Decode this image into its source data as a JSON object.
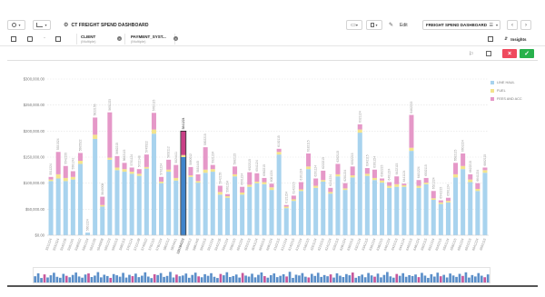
{
  "toolbar": {
    "title": "CT FREIGHT SPEND DASHBOARD",
    "edit_label": "Edit",
    "dashboard_label": "FREIGHT SPEND DASHBOARD",
    "insights_label": "Insights"
  },
  "filters": [
    {
      "name": "CLIENT",
      "value": "(Multiple)"
    },
    {
      "name": "PAYMENT_SYST...",
      "value": "(Multiple)"
    }
  ],
  "icons": {
    "dash_menu": "dashboard-icon",
    "chart_type": "chart-icon",
    "settings": "gear-icon",
    "comment": "comment-icon",
    "save": "save-icon",
    "pen": "pen-icon",
    "prev": "chevron-left-icon",
    "next": "chevron-right-icon",
    "cancel": "close-icon",
    "confirm": "check-icon"
  },
  "colors": {
    "line_haul": "#a8d3ee",
    "fuel": "#f3e38c",
    "fees_and_acc": "#e598c8",
    "selected_line_haul": "#3f84cb",
    "selected_fees": "#c93f86",
    "cancel_btn": "#ef4a5e",
    "confirm_btn": "#28b14c"
  },
  "chart_data": {
    "type": "bar",
    "stacked": true,
    "ylim": [
      0,
      300000
    ],
    "yticks": [
      "$300,000.00",
      "$250,000.00",
      "$200,000.00",
      "$150,000.00",
      "$100,000.00",
      "$50,000.00",
      "$0.00"
    ],
    "selected_index": 18,
    "selected_label": "159184223",
    "legend": [
      "LINE HAUL",
      "FUEL",
      "FEES AND ACC"
    ],
    "categories": [
      "5511224",
      "5531524",
      "5542155",
      "5561241",
      "5585522",
      "5601224",
      "5622155",
      "5640008",
      "5651223",
      "5662215",
      "5682115",
      "5701124",
      "5722148",
      "5745522",
      "5762115",
      "5781224",
      "5802112",
      "5824411",
      "5841224",
      "5860012",
      "5881445",
      "5902215",
      "5921224",
      "5942155",
      "5961224",
      "5982115",
      "6001224",
      "6022115",
      "6041124",
      "6062215",
      "6081224",
      "6102115",
      "6121224",
      "6142215",
      "6161224",
      "6182115",
      "6201124",
      "6222215",
      "6241224",
      "6262115",
      "6281224",
      "6302215",
      "6321124",
      "6342115",
      "6361224",
      "6382215",
      "6401224",
      "6422115",
      "6441124",
      "6462215",
      "6481224",
      "6502115",
      "6521224",
      "6542215",
      "6561124",
      "6582115",
      "6601224",
      "6622215",
      "6641224",
      "6662115"
    ],
    "series": [
      {
        "name": "LINE HAUL",
        "values": [
          104000,
          109000,
          104000,
          107000,
          137000,
          5000,
          185000,
          55000,
          145000,
          125000,
          122000,
          118000,
          114000,
          128000,
          195000,
          100000,
          122000,
          105000,
          150000,
          112000,
          101000,
          120000,
          122000,
          78000,
          72000,
          113000,
          78000,
          93000,
          100000,
          98000,
          87000,
          155000,
          52000,
          66000,
          85000,
          127000,
          91000,
          103000,
          80000,
          113000,
          87000,
          111000,
          197000,
          114000,
          106000,
          101000,
          91000,
          93000,
          93000,
          162000,
          91000,
          98000,
          68000,
          60000,
          63000,
          111000,
          127000,
          102000,
          85000,
          120000
        ]
      },
      {
        "name": "FUEL",
        "values": [
          3000,
          8000,
          6000,
          5000,
          6000,
          0,
          8000,
          3000,
          4000,
          5000,
          5000,
          4000,
          4000,
          3000,
          8000,
          3000,
          4000,
          5000,
          4000,
          3000,
          3000,
          6000,
          5000,
          5000,
          3000,
          4000,
          4000,
          4000,
          3000,
          4000,
          5000,
          5000,
          3000,
          3000,
          3000,
          5000,
          4000,
          3000,
          3000,
          4000,
          3000,
          4000,
          6000,
          4000,
          4000,
          4000,
          4000,
          5000,
          3000,
          6000,
          4000,
          3000,
          3000,
          3000,
          3000,
          6000,
          6000,
          5000,
          4000,
          5000
        ]
      },
      {
        "name": "FEES AND ACC",
        "values": [
          5000,
          43000,
          23000,
          11000,
          15000,
          0,
          33000,
          16000,
          87000,
          22000,
          12000,
          8000,
          9000,
          24000,
          32000,
          9000,
          19000,
          25000,
          46000,
          16000,
          13000,
          43000,
          8000,
          12000,
          4000,
          15000,
          11000,
          24000,
          16000,
          8000,
          7000,
          6000,
          3000,
          7000,
          14000,
          25000,
          14000,
          18000,
          8000,
          20000,
          10000,
          17000,
          10000,
          11000,
          16000,
          4000,
          7000,
          15000,
          3000,
          63000,
          11000,
          9000,
          14000,
          4000,
          6000,
          22000,
          24000,
          10000,
          11000,
          5000
        ]
      }
    ]
  },
  "minimap_data": [
    57,
    84,
    41,
    74,
    46,
    66,
    89,
    52,
    43,
    79,
    61,
    48,
    69,
    91,
    55,
    44,
    73,
    83,
    50,
    63,
    95,
    47,
    71,
    59,
    42,
    77,
    66,
    53,
    88,
    45,
    70,
    58,
    81,
    49,
    62,
    93,
    54,
    40,
    75,
    68,
    86,
    51,
    60,
    97,
    46,
    72,
    57,
    64,
    82,
    43,
    69,
    90,
    56,
    48,
    76,
    61,
    85,
    52,
    41,
    78,
    66,
    94,
    50,
    59,
    73,
    45,
    87,
    63,
    54,
    80,
    47,
    70,
    92,
    58,
    44,
    67,
    83,
    49,
    61,
    75,
    55,
    98,
    42,
    71,
    64,
    86,
    53,
    46,
    79,
    60,
    89,
    51,
    68,
    57,
    74,
    45,
    84,
    62,
    50,
    77,
    66,
    91,
    43,
    58,
    72,
    48,
    87,
    65,
    53,
    81,
    47,
    69,
    96,
    56,
    44,
    78,
    61,
    85,
    52,
    67,
    59,
    73,
    49,
    88,
    63,
    42,
    76,
    54,
    90,
    57,
    70,
    46,
    82,
    64,
    51,
    79,
    60,
    93,
    45,
    68,
    55,
    86,
    62,
    48,
    74
  ]
}
